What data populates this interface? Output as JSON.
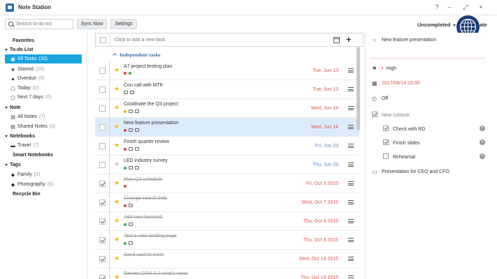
{
  "app": {
    "title": "Note Station"
  },
  "window": {
    "help": "?",
    "minimize": "–",
    "restore": "⤢",
    "close": "×"
  },
  "toolbar": {
    "search_placeholder": "Search to-do list",
    "sync_label": "Sync Now",
    "settings_label": "Settings",
    "filter_label": "Uncompleted",
    "avatar_text": "ate"
  },
  "sidebar": {
    "favorites": "Favorites",
    "todo_header": "To-do List",
    "todo_items": [
      {
        "label": "All Tasks",
        "count": "(30)",
        "icon": "▣"
      },
      {
        "label": "Starred",
        "count": "(20)",
        "icon": "★"
      },
      {
        "label": "Overdue",
        "count": "(0)",
        "icon": "▲"
      },
      {
        "label": "Today",
        "count": "(0)",
        "icon": "▢"
      },
      {
        "label": "Next 7 days",
        "count": "(0)",
        "icon": "▢"
      }
    ],
    "note_header": "Note",
    "note_items": [
      {
        "label": "All Notes",
        "count": "(7)",
        "icon": "▤"
      },
      {
        "label": "Shared Notes",
        "count": "(0)",
        "icon": "▤"
      }
    ],
    "notebooks_header": "Notebooks",
    "notebook_items": [
      {
        "label": "Travel",
        "count": "(7)",
        "icon": "▬"
      }
    ],
    "smart_notebooks": "Smart Notebooks",
    "tags_header": "Tags",
    "tag_items": [
      {
        "label": "Family",
        "count": "(3)",
        "icon": "◆"
      },
      {
        "label": "Photography",
        "count": "(6)",
        "icon": "◆"
      }
    ],
    "recycle_bin": "Recycle Bin"
  },
  "list": {
    "add_placeholder": "Click to add a new task",
    "group_title": "Independent tasks",
    "tasks": [
      {
        "title": "A7 project testing plan",
        "date": "Tue, Jun 13",
        "date_color": "red",
        "starred": true,
        "done": false,
        "dots": [
          "red",
          "green"
        ],
        "icons": []
      },
      {
        "title": "Con call with MTK",
        "date": "Tue, Jun 13",
        "date_color": "red",
        "starred": true,
        "done": false,
        "dots": [],
        "icons": [
          "mail",
          "mail"
        ]
      },
      {
        "title": "Coodinate the Q3 project",
        "date": "Wed, Jun 14",
        "date_color": "red",
        "starred": true,
        "done": false,
        "dots": [
          "yellow"
        ],
        "icons": [
          "mail",
          "mail"
        ]
      },
      {
        "title": "New feature presentation",
        "date": "Wed, Jun 14",
        "date_color": "red",
        "starred": true,
        "done": false,
        "dots": [
          "red"
        ],
        "icons": [
          "chat",
          "mail"
        ],
        "selected": true
      },
      {
        "title": "Finish quarter review",
        "date": "Fri, Jun 23",
        "date_color": "blue",
        "starred": true,
        "done": false,
        "dots": [
          "red"
        ],
        "icons": [
          "chat",
          "mail"
        ]
      },
      {
        "title": "LED industry survey",
        "date": "Thu, Jun 29",
        "date_color": "blue",
        "starred": false,
        "done": false,
        "dots": [
          "green"
        ],
        "icons": [
          "chat",
          "mail"
        ]
      },
      {
        "title": "Plan Q3 schedule",
        "date": "Fri, Oct 2 2015",
        "date_color": "red",
        "starred": true,
        "done": true,
        "dots": [
          "red"
        ],
        "icons": []
      },
      {
        "title": "Change search bids",
        "date": "Wed, Oct 7 2015",
        "date_color": "red",
        "starred": true,
        "done": true,
        "dots": [
          "red"
        ],
        "icons": [
          "mail"
        ]
      },
      {
        "title": "Add new keyword",
        "date": "Thu, Oct 8 2015",
        "date_color": "red",
        "starred": true,
        "done": true,
        "dots": [
          "green"
        ],
        "icons": [
          "mail"
        ]
      },
      {
        "title": "Test a new landing page",
        "date": "Thu, Oct 8 2015",
        "date_color": "red",
        "starred": true,
        "done": true,
        "dots": [
          "green"
        ],
        "icons": [
          "mail"
        ]
      },
      {
        "title": "Send card to mom",
        "date": "Wed, Oct 14 2015",
        "date_color": "red",
        "starred": true,
        "done": true,
        "dots": [],
        "icons": []
      },
      {
        "title": "Review DSM 6.0 what's news",
        "date": "Thu, Oct 15 2015",
        "date_color": "red",
        "starred": true,
        "done": true,
        "dots": [],
        "icons": []
      }
    ]
  },
  "detail": {
    "title": "New feature presentation",
    "priority": "High",
    "due": "2017/06/14 18:00",
    "reminder": "Off",
    "new_subtask": "New subtask",
    "subtasks": [
      {
        "label": "Check with RD",
        "done": true
      },
      {
        "label": "Finish slides",
        "done": true
      },
      {
        "label": "Rehearsal",
        "done": false
      }
    ],
    "note": "Presentation for CEO and CFO"
  },
  "colors": {
    "accent": "#19a3e0",
    "overdue": "#e0574f",
    "upcoming": "#5a8fc5",
    "star": "#f5b800"
  }
}
